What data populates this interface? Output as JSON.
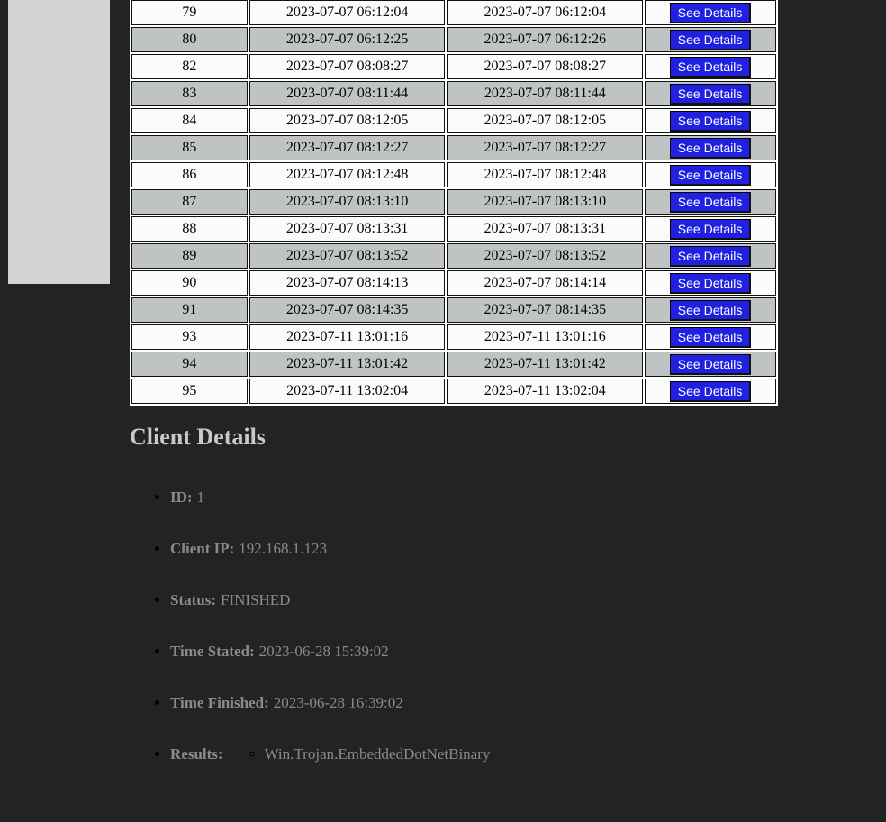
{
  "table": {
    "action_label": "See Details",
    "rows": [
      {
        "id": "79",
        "start": "2023-07-07 06:12:04",
        "end": "2023-07-07 06:12:04"
      },
      {
        "id": "80",
        "start": "2023-07-07 06:12:25",
        "end": "2023-07-07 06:12:26"
      },
      {
        "id": "82",
        "start": "2023-07-07 08:08:27",
        "end": "2023-07-07 08:08:27"
      },
      {
        "id": "83",
        "start": "2023-07-07 08:11:44",
        "end": "2023-07-07 08:11:44"
      },
      {
        "id": "84",
        "start": "2023-07-07 08:12:05",
        "end": "2023-07-07 08:12:05"
      },
      {
        "id": "85",
        "start": "2023-07-07 08:12:27",
        "end": "2023-07-07 08:12:27"
      },
      {
        "id": "86",
        "start": "2023-07-07 08:12:48",
        "end": "2023-07-07 08:12:48"
      },
      {
        "id": "87",
        "start": "2023-07-07 08:13:10",
        "end": "2023-07-07 08:13:10"
      },
      {
        "id": "88",
        "start": "2023-07-07 08:13:31",
        "end": "2023-07-07 08:13:31"
      },
      {
        "id": "89",
        "start": "2023-07-07 08:13:52",
        "end": "2023-07-07 08:13:52"
      },
      {
        "id": "90",
        "start": "2023-07-07 08:14:13",
        "end": "2023-07-07 08:14:14"
      },
      {
        "id": "91",
        "start": "2023-07-07 08:14:35",
        "end": "2023-07-07 08:14:35"
      },
      {
        "id": "93",
        "start": "2023-07-11 13:01:16",
        "end": "2023-07-11 13:01:16"
      },
      {
        "id": "94",
        "start": "2023-07-11 13:01:42",
        "end": "2023-07-11 13:01:42"
      },
      {
        "id": "95",
        "start": "2023-07-11 13:02:04",
        "end": "2023-07-11 13:02:04"
      }
    ]
  },
  "client": {
    "title": "Client Details",
    "id_label": "ID:",
    "id_value": "1",
    "ip_label": "Client IP:",
    "ip_value": "192.168.1.123",
    "status_label": "Status:",
    "status_value": "FINISHED",
    "started_label": "Time Stated:",
    "started_value": "2023-06-28 15:39:02",
    "finished_label": "Time Finished:",
    "finished_value": "2023-06-28 16:39:02",
    "results_label": "Results:",
    "results": [
      "Win.Trojan.EmbeddedDotNetBinary"
    ]
  },
  "colors": {
    "page_bg": "#232323",
    "button_bg": "#2020e0",
    "row_alt": "#bfc3c3",
    "sidebar": "#d3d3d3"
  }
}
